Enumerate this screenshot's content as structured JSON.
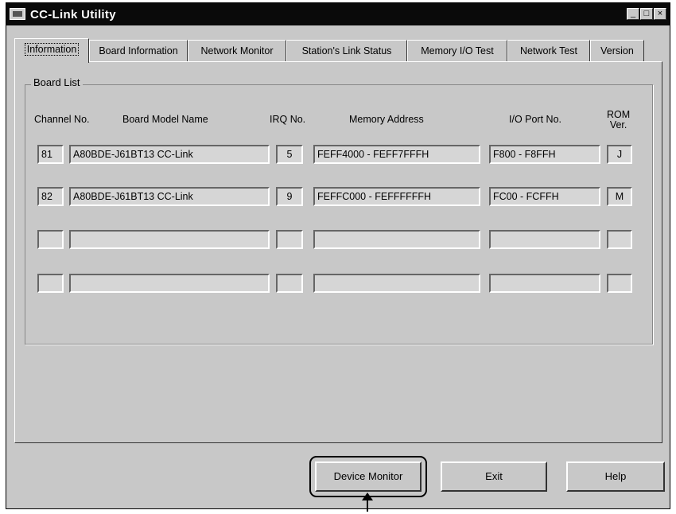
{
  "window": {
    "title": "CC-Link Utility"
  },
  "tabs": [
    {
      "label": "Information"
    },
    {
      "label": "Board Information"
    },
    {
      "label": "Network Monitor"
    },
    {
      "label": "Station's Link Status"
    },
    {
      "label": "Memory I/O Test"
    },
    {
      "label": "Network Test"
    },
    {
      "label": "Version"
    }
  ],
  "board_list": {
    "legend": "Board List",
    "headers": {
      "channel": "Channel No.",
      "model": "Board Model Name",
      "irq": "IRQ No.",
      "memory": "Memory Address",
      "io_port": "I/O Port No.",
      "rom_line1": "ROM",
      "rom_line2": "Ver."
    },
    "rows": [
      {
        "channel": "81",
        "model": "A80BDE-J61BT13 CC-Link",
        "irq": "5",
        "memory": "FEFF4000 - FEFF7FFFH",
        "io_port": "F800 - F8FFH",
        "rom": "J"
      },
      {
        "channel": "82",
        "model": "A80BDE-J61BT13 CC-Link",
        "irq": "9",
        "memory": "FEFFC000 - FEFFFFFFH",
        "io_port": "FC00 - FCFFH",
        "rom": "M"
      },
      {
        "channel": "",
        "model": "",
        "irq": "",
        "memory": "",
        "io_port": "",
        "rom": ""
      },
      {
        "channel": "",
        "model": "",
        "irq": "",
        "memory": "",
        "io_port": "",
        "rom": ""
      }
    ]
  },
  "buttons": {
    "device_monitor": "Device Monitor",
    "exit": "Exit",
    "help": "Help"
  }
}
